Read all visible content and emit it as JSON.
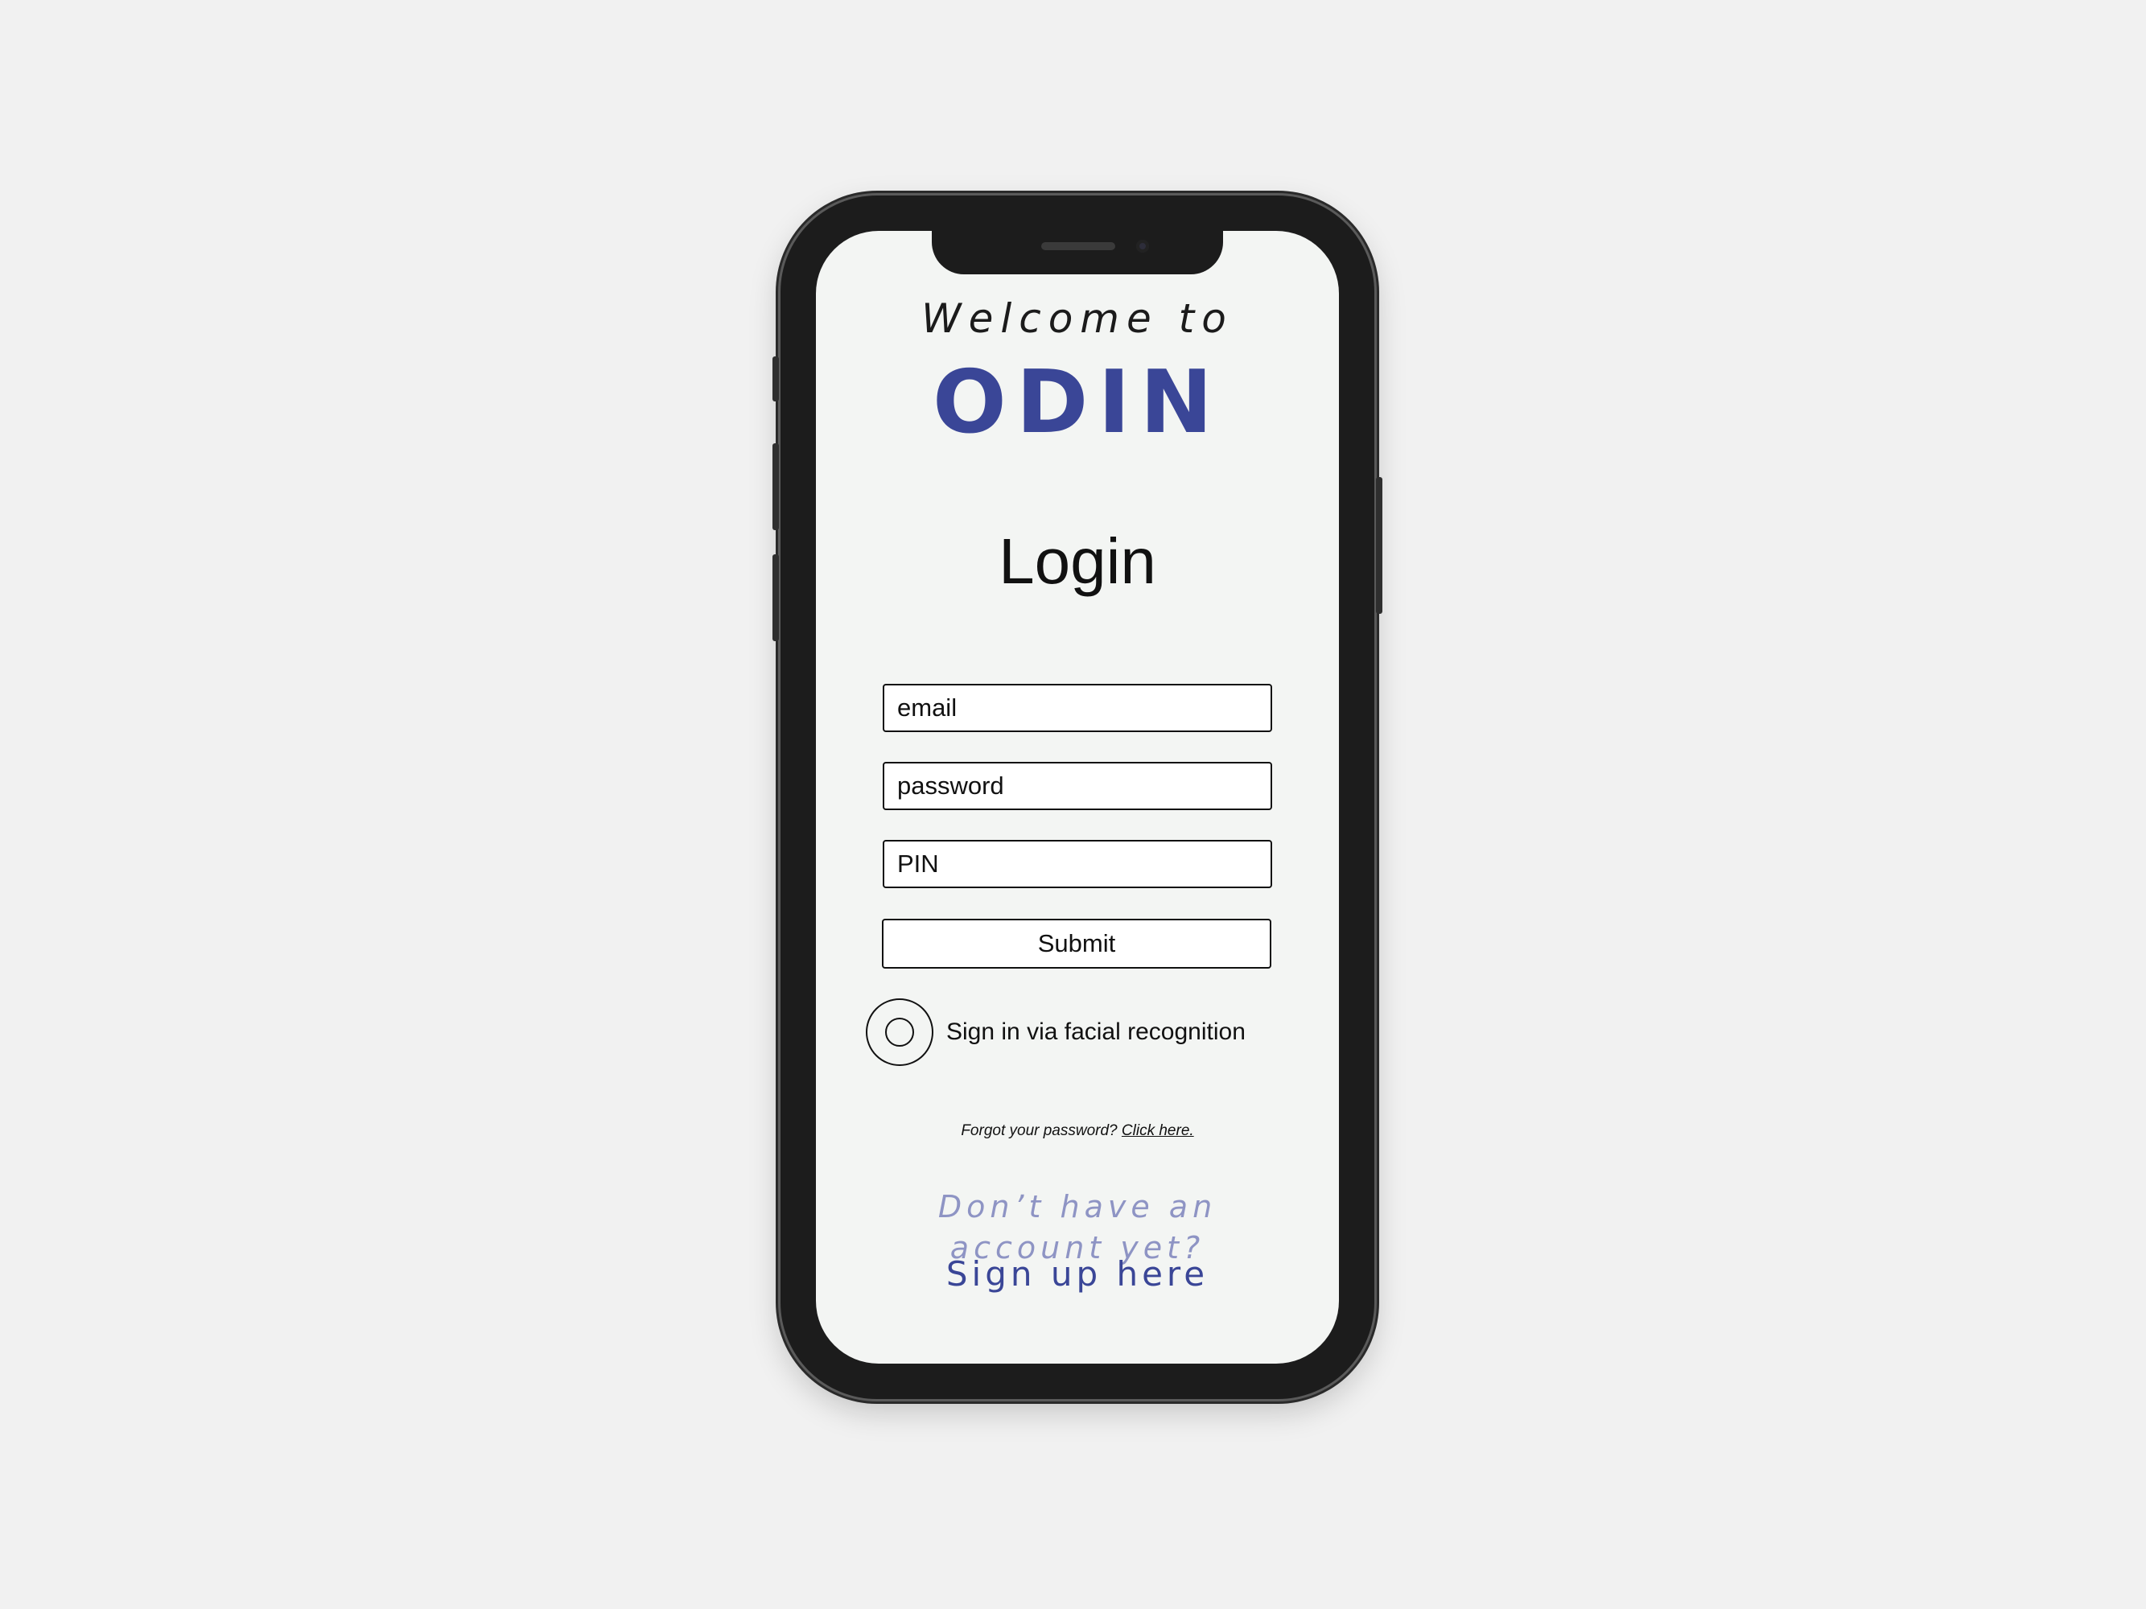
{
  "colors": {
    "background": "#f1f1f1",
    "screen": "#f3f5f3",
    "brand": "#3a4697",
    "prompt": "#8e94c4",
    "phone_frame": "#1c1c1c"
  },
  "header": {
    "welcome": "Welcome to",
    "brand": "ODIN"
  },
  "login": {
    "title": "Login",
    "email_placeholder": "email",
    "password_placeholder": "password",
    "pin_placeholder": "PIN",
    "submit_label": "Submit",
    "face_id_label": "Sign in via facial recognition",
    "face_id_icon": "face-recognition-icon",
    "forgot_text": "Forgot your password?",
    "forgot_link": "Click here."
  },
  "signup": {
    "prompt_line1": "Don’t have an",
    "prompt_line2": "account yet?",
    "link": "Sign up here"
  }
}
